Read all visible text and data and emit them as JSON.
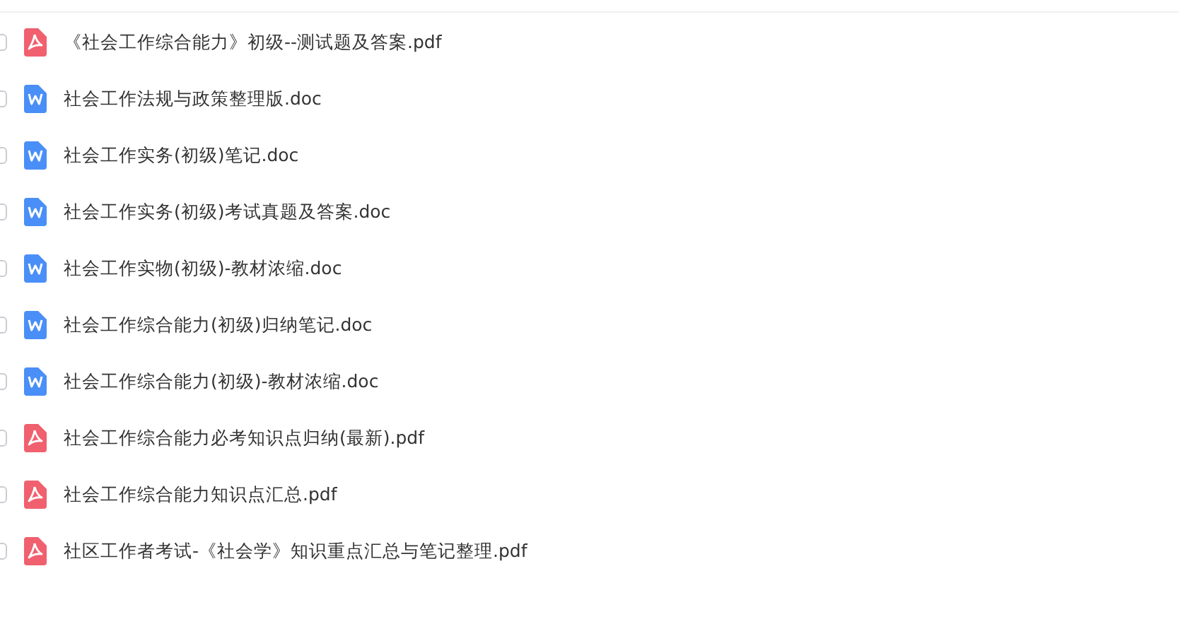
{
  "files": [
    {
      "name": "《社会工作综合能力》初级--测试题及答案.pdf",
      "kind": "pdf",
      "checked": false
    },
    {
      "name": "社会工作法规与政策整理版.doc",
      "kind": "doc",
      "checked": false
    },
    {
      "name": "社会工作实务(初级)笔记.doc",
      "kind": "doc",
      "checked": false
    },
    {
      "name": "社会工作实务(初级)考试真题及答案.doc",
      "kind": "doc",
      "checked": false
    },
    {
      "name": "社会工作实物(初级)-教材浓缩.doc",
      "kind": "doc",
      "checked": false
    },
    {
      "name": "社会工作综合能力(初级)归纳笔记.doc",
      "kind": "doc",
      "checked": false
    },
    {
      "name": "社会工作综合能力(初级)-教材浓缩.doc",
      "kind": "doc",
      "checked": false
    },
    {
      "name": "社会工作综合能力必考知识点归纳(最新).pdf",
      "kind": "pdf",
      "checked": false
    },
    {
      "name": "社会工作综合能力知识点汇总.pdf",
      "kind": "pdf",
      "checked": false
    },
    {
      "name": "社区工作者考试-《社会学》知识重点汇总与笔记整理.pdf",
      "kind": "pdf",
      "checked": false
    }
  ]
}
